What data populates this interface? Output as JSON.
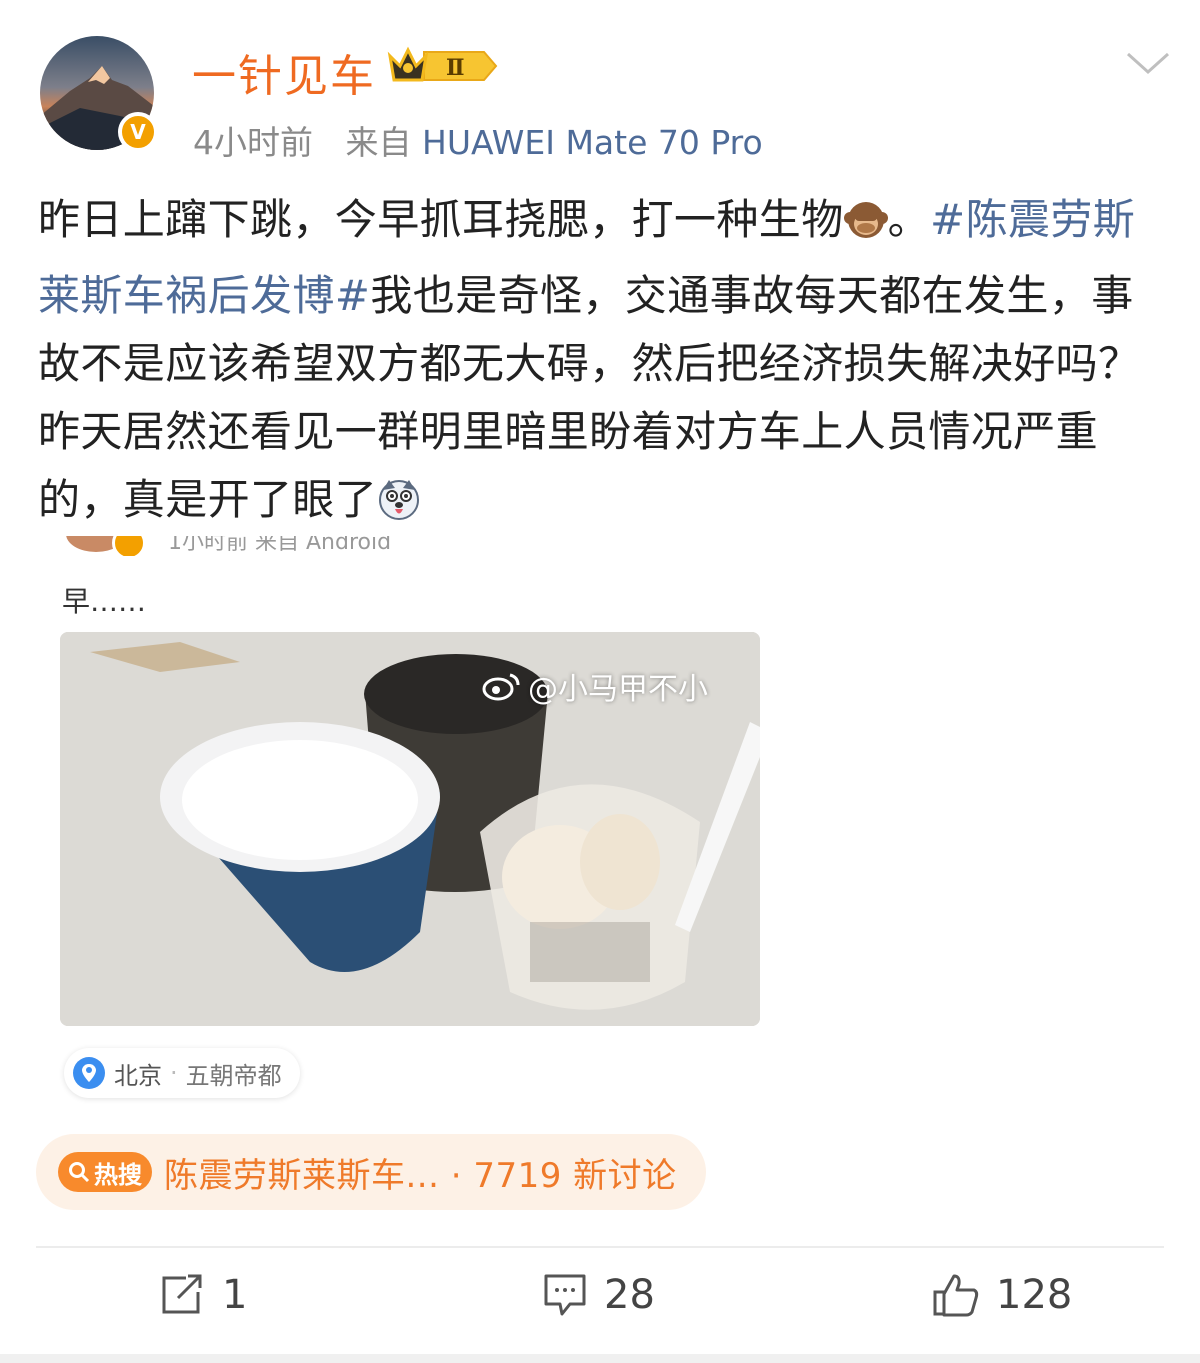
{
  "header": {
    "username": "一针见车",
    "level_badge": "Ⅱ",
    "time": "4小时前",
    "source_prefix": "来自",
    "source": "HUAWEI Mate 70 Pro",
    "verified_badge": "V"
  },
  "post": {
    "text_1": "昨日上蹿下跳，今早抓耳挠腮，打一种生物",
    "emoji_1": "monkey-emoji",
    "text_2": "。",
    "hashtag": "#陈震劳斯莱斯车祸后发博#",
    "text_3": "我也是奇怪，交通事故每天都在发生，事故不是应该希望双方都无大碍，然后把经济损失解决好吗？昨天居然还看见一群明里暗里盼着对方车上人员情况严重的，真是开了眼了",
    "emoji_2": "husky-emoji"
  },
  "embed": {
    "meta": "1小时前  来自 Android",
    "text": "早……",
    "watermark": "@小马甲不小",
    "location": "北京",
    "location_sub": "五朝帝都"
  },
  "hot_search": {
    "pill_label": "热搜",
    "text": "陈震劳斯莱斯车... · 7719 新讨论"
  },
  "actions": {
    "repost_count": "1",
    "comment_count": "28",
    "like_count": "128"
  },
  "colors": {
    "username": "#ef6a21",
    "link": "#4e6b98",
    "hot": "#f88a2c"
  }
}
